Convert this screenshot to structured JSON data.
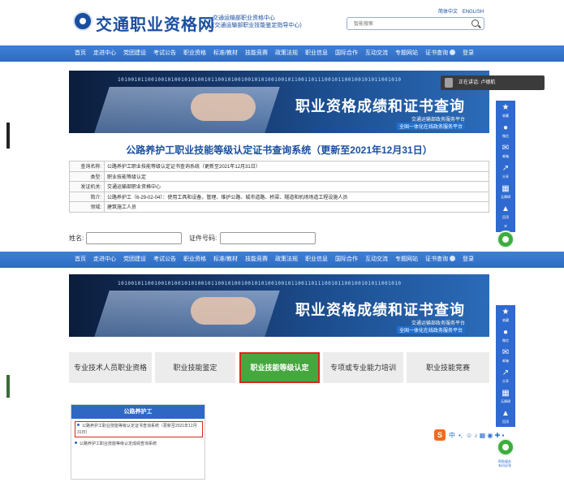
{
  "site": {
    "name": "交通职业资格网",
    "org_line1": "交通运输部职业资格中心",
    "org_line2": "(交通运输部职业技能鉴定指导中心)",
    "lang_cn": "简体中文",
    "lang_en": "ENGLISH",
    "search_placeholder": "智能搜索"
  },
  "nav_items": [
    "首页",
    "走进中心",
    "党团建设",
    "考试公告",
    "职业资格",
    "标准/教材",
    "技能竞赛",
    "政策法规",
    "职业信息",
    "国际合作",
    "互动交流",
    "专题网站",
    "证书查询",
    "登录"
  ],
  "banner": {
    "code": "1010010110010010100101010010110010100100101010010010110011011100101100100101011001010",
    "title": "职业资格成绩和证书查询",
    "sub1": "交通运输部政务服务平台",
    "sub2": "全国一体化在线政务服务平台"
  },
  "welcome": "正在讲话: 卢德航",
  "sidebar": [
    {
      "icon": "★",
      "label": "收藏"
    },
    {
      "icon": "●",
      "label": "微信"
    },
    {
      "icon": "✉",
      "label": "邮箱"
    },
    {
      "icon": "↗",
      "label": "分享"
    },
    {
      "icon": "▦",
      "label": "无障碍"
    },
    {
      "icon": "▲",
      "label": "回顶"
    }
  ],
  "result": {
    "title": "公路养护工职业技能等级认定证书查询系统（更新至2021年12月31日）",
    "rows": [
      {
        "key": "查询名称:",
        "value": "公路养护工职业技能等级认定证书查询系统（更新至2021年12月31日）"
      },
      {
        "key": "类型:",
        "value": "职业技能等级认定"
      },
      {
        "key": "发证机关:",
        "value": "交通运输部职业资格中心"
      },
      {
        "key": "简介:",
        "value": "公路养护工（6-29-02-04）：使用工具和设备，管理、维护公路、城市道路、桥梁、隧道和机场场道工程设施人员"
      },
      {
        "key": "领域:",
        "value": "建筑施工人员"
      }
    ],
    "name_label": "姓名:",
    "cert_label": "证件号码:"
  },
  "category_tabs": [
    "专业技术人员职业资格",
    "职业技能鉴定",
    "职业技能等级认定",
    "专项或专业能力培训",
    "职业技能竞赛"
  ],
  "panel": {
    "heading": "公路养护工",
    "item1": "公路养护工职业技能等级认定证书查询系统（更新至2021年12月31日）",
    "item2": "公路养护工职业技能等级认定成绩查询系统"
  },
  "ime": {
    "logo": "S",
    "lang": "中",
    "marks": "•,",
    "icons": "☺ ♪ ▦ ◉ ✚ ▪"
  },
  "green_caption": "帮助服务\n有问必答",
  "colors": {
    "brand": "#1a4fa0",
    "nav": "#2f6cc4",
    "active_tab": "#45a83e",
    "highlight": "#d9261c"
  }
}
